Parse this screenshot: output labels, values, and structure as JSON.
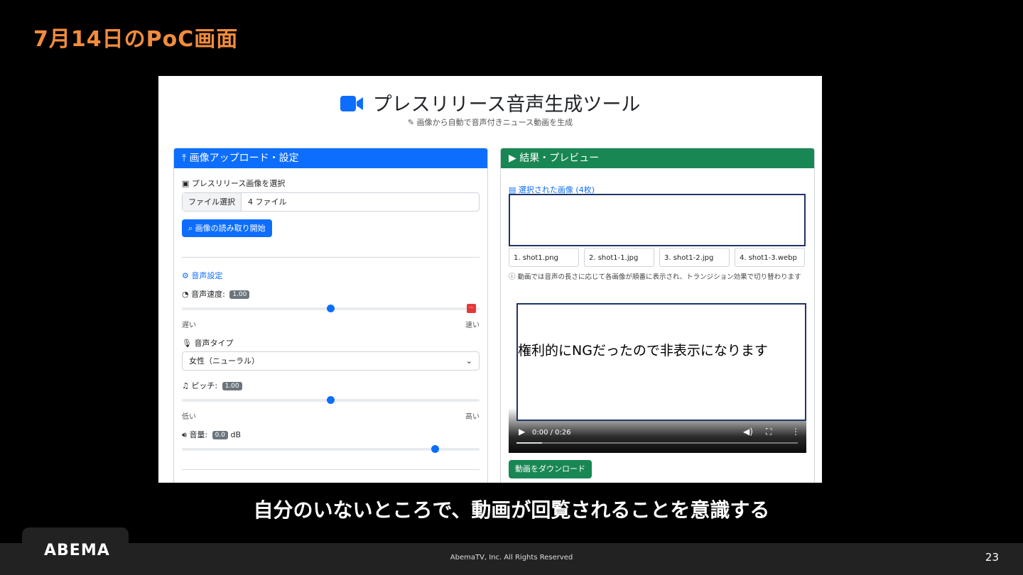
{
  "slide": {
    "title": "7月14日のPoC画面",
    "caption": "自分のいないところで、動画が回覧されることを意識する",
    "logo": "ABEMA",
    "copyright": "AbemaTV, Inc. All Rights Reserved",
    "page_number": "23"
  },
  "app": {
    "title": "プレスリリース音声生成ツール",
    "subtitle": "画像から自動で音声付きニュース動画を生成",
    "title_icon": "video-camera-icon",
    "accent_blue": "#0d6efd",
    "accent_green": "#198754"
  },
  "upload_panel": {
    "header": "画像アップロード・設定",
    "image_select_label": "プレスリリース画像を選択",
    "file_button": "ファイル選択",
    "file_value": "4 ファイル",
    "read_button": "画像の読み取り開始",
    "voice_settings_label": "音声設定",
    "speed": {
      "label": "音声速度:",
      "value": "1.00",
      "level": 0.5,
      "min_label": "遅い",
      "max_label": "速い"
    },
    "voice_type": {
      "label": "音声タイプ",
      "selected": "女性（ニューラル）"
    },
    "pitch": {
      "label": "ピッチ:",
      "value": "1.00",
      "level": 0.5,
      "min_label": "低い",
      "max_label": "高い"
    },
    "volume": {
      "label": "音量:",
      "value": "0.0",
      "unit": "dB",
      "level": 0.85
    }
  },
  "result_panel": {
    "header": "結果・プレビュー",
    "selected_images_label": "選択された画像 (4枚)",
    "files": [
      "1. shot1.png",
      "2. shot1-1.jpg",
      "3. shot1-2.jpg",
      "4. shot1-3.webp"
    ],
    "note": "動画では音声の長さに応じて各画像が順番に表示され、トランジション効果で切り替わります",
    "redacted_notice": "権利的にNGだったので非表示になります",
    "video_time": "0:00 / 0:26",
    "video_progress": 0.09,
    "download_button": "動画をダウンロード"
  }
}
